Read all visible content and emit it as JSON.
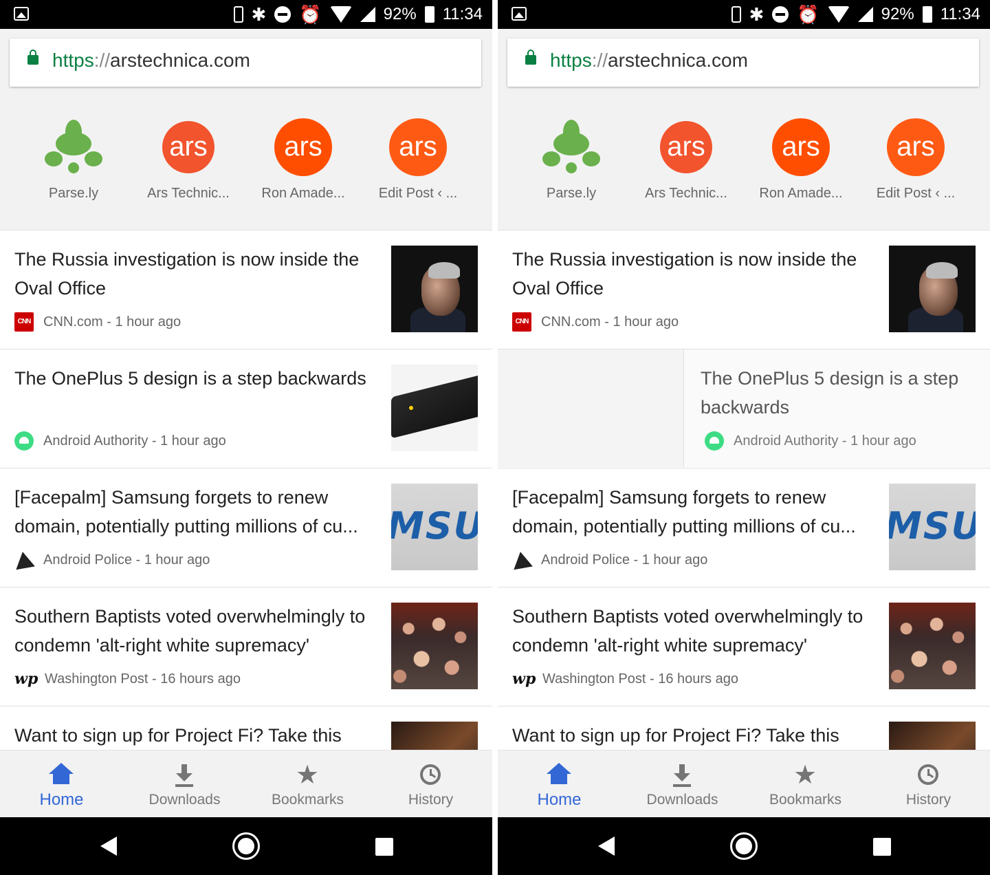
{
  "status_bar": {
    "battery": "92%",
    "time": "11:34"
  },
  "url_bar": {
    "scheme": "https",
    "separator": "://",
    "host": "arstechnica.com"
  },
  "tiles": [
    {
      "label": "Parse.ly",
      "icon": "parsely-leaf-icon"
    },
    {
      "label": "Ars Technic...",
      "icon": "ars-logo-icon",
      "text": "ars"
    },
    {
      "label": "Ron Amade...",
      "icon": "ars-logo-icon",
      "text": "ars"
    },
    {
      "label": "Edit Post ‹ ...",
      "icon": "ars-logo-icon",
      "text": "ars"
    }
  ],
  "articles": [
    {
      "title": "The Russia investigation is now inside the Oval Office",
      "source": "CNN.com - 1 hour ago",
      "source_icon": "cnn-icon",
      "cnn_text": "CNN"
    },
    {
      "title": "The OnePlus 5 design is a step backwards",
      "source": "Android Authority - 1 hour ago",
      "source_icon": "android-authority-icon"
    },
    {
      "title": "[Facepalm] Samsung forgets to renew domain, potentially putting millions of cu...",
      "source": "Android Police - 1 hour ago",
      "source_icon": "android-police-icon",
      "thumb_text": "MSUN"
    },
    {
      "title": "Southern Baptists voted overwhelmingly to condemn 'alt-right white supremacy'",
      "source": "Washington Post - 16 hours ago",
      "source_icon": "washington-post-icon",
      "wp_text": "wp"
    },
    {
      "title": "Want to sign up for Project Fi? Take this",
      "source": "",
      "source_icon": ""
    }
  ],
  "bottom_nav": [
    {
      "label": "Home",
      "active": true
    },
    {
      "label": "Downloads",
      "active": false
    },
    {
      "label": "Bookmarks",
      "active": false
    },
    {
      "label": "History",
      "active": false
    }
  ],
  "colors": {
    "accent": "#3367d6",
    "secure": "#0b8043",
    "ars": "#ff4e00"
  }
}
